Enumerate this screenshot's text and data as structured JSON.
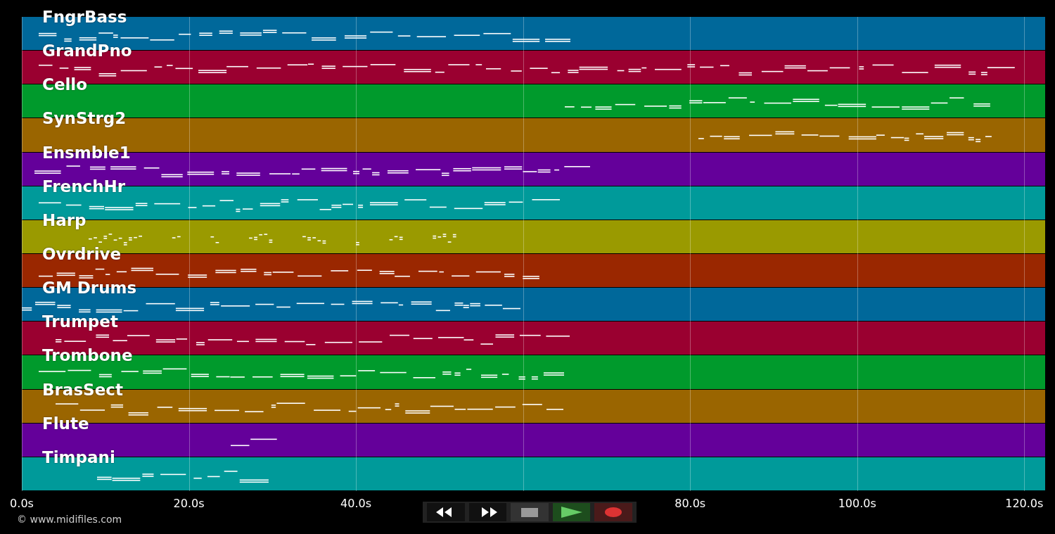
{
  "tracks": [
    {
      "name": "FngrBass",
      "color": "#00689a"
    },
    {
      "name": "GrandPno",
      "color": "#9a0030"
    },
    {
      "name": "Cello",
      "color": "#009a2c"
    },
    {
      "name": "SynStrg2",
      "color": "#9a6500"
    },
    {
      "name": "Ensmble1",
      "color": "#64009a"
    },
    {
      "name": "FrenchHr",
      "color": "#009a9a"
    },
    {
      "name": "Harp",
      "color": "#9a9a00"
    },
    {
      "name": "Ovrdrive",
      "color": "#9a2700"
    },
    {
      "name": "GM Drums",
      "color": "#00689a"
    },
    {
      "name": "Trumpet",
      "color": "#9a0030"
    },
    {
      "name": "Trombone",
      "color": "#009a2c"
    },
    {
      "name": "BrasSect",
      "color": "#9a6500"
    },
    {
      "name": "Flute",
      "color": "#64009a"
    },
    {
      "name": "Timpani",
      "color": "#009a9a"
    }
  ],
  "time_axis": {
    "ticks": [
      "0.0s",
      "20.0s",
      "40.0s",
      "80.0s",
      "100.0s",
      "120.0s"
    ]
  },
  "copyright": "© www.midifiles.com",
  "transport": [
    {
      "kind": "rewind"
    },
    {
      "kind": "forward"
    },
    {
      "kind": "stop"
    },
    {
      "kind": "play"
    },
    {
      "kind": "record"
    }
  ]
}
